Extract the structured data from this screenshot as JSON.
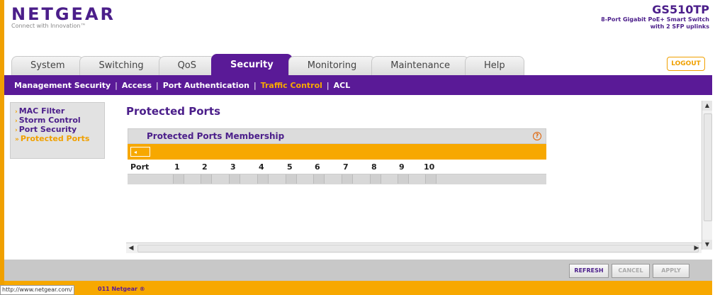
{
  "brand": {
    "name": "NETGEAR",
    "tagline": "Connect with Innovation™"
  },
  "device": {
    "model": "GS510TP",
    "description_line1": "8-Port Gigabit PoE+ Smart Switch",
    "description_line2": "with 2 SFP uplinks"
  },
  "tabs": [
    {
      "label": "System"
    },
    {
      "label": "Switching"
    },
    {
      "label": "QoS"
    },
    {
      "label": "Security"
    },
    {
      "label": "Monitoring"
    },
    {
      "label": "Maintenance"
    },
    {
      "label": "Help"
    }
  ],
  "logout_label": "LOGOUT",
  "subnav": [
    {
      "label": "Management Security"
    },
    {
      "label": "Access"
    },
    {
      "label": "Port Authentication"
    },
    {
      "label": "Traffic Control"
    },
    {
      "label": "ACL"
    }
  ],
  "sidemenu": [
    {
      "label": "MAC Filter"
    },
    {
      "label": "Storm Control"
    },
    {
      "label": "Port Security"
    },
    {
      "label": "Protected Ports"
    }
  ],
  "page_title": "Protected Ports",
  "panel": {
    "title": "Protected Ports Membership",
    "help": "?",
    "collapse_glyph": "◂",
    "port_label": "Port",
    "ports": [
      "1",
      "2",
      "3",
      "4",
      "5",
      "6",
      "7",
      "8",
      "9",
      "10"
    ]
  },
  "buttons": {
    "refresh": "REFRESH",
    "cancel": "CANCEL",
    "apply": "APPLY"
  },
  "status_url": "http://www.netgear.com/",
  "copyright": "011 Netgear ®",
  "colors": {
    "brand_purple": "#5a1a97",
    "accent_orange": "#f7a800"
  }
}
